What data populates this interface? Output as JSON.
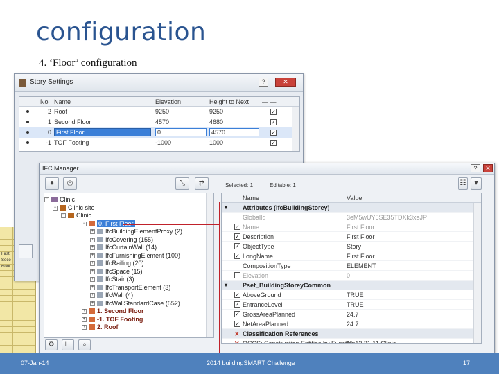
{
  "slide": {
    "title": "configuration",
    "subtitle": "4. ‘Floor’ configuration",
    "footer_date": "07-Jan-14",
    "footer_center": "2014 buildingSMART Challenge",
    "page_number": "17"
  },
  "story_settings": {
    "title": "Story Settings",
    "columns": {
      "no": "No",
      "name": "Name",
      "elevation": "Elevation",
      "height": "Height to Next",
      "show": "— —"
    },
    "rows": [
      {
        "no": "2",
        "name": "Roof",
        "elevation": "9250",
        "height": "9250",
        "checked": true,
        "selected": false
      },
      {
        "no": "1",
        "name": "Second Floor",
        "elevation": "4570",
        "height": "4680",
        "checked": true,
        "selected": false
      },
      {
        "no": "0",
        "name": "First Floor",
        "elevation": "0",
        "height": "4570",
        "checked": true,
        "selected": true
      },
      {
        "no": "-1",
        "name": "TOF Footing",
        "elevation": "-1000",
        "height": "1000",
        "checked": true,
        "selected": false
      }
    ]
  },
  "sheet_fragment": [
    "First",
    "Seco",
    "Roof"
  ],
  "ifc_manager": {
    "title": "IFC Manager",
    "selected_label": "Selected:",
    "selected_value": "1",
    "editable_label": "Editable:",
    "editable_value": "1",
    "tree": [
      {
        "label": "Clinic",
        "level": 0
      },
      {
        "label": "Clinic site",
        "level": 1
      },
      {
        "label": "Clinic",
        "level": 2
      },
      {
        "label": "0. First Floor",
        "level": 3,
        "highlight": true
      },
      {
        "label": "IfcBuildingElementProxy (2)",
        "level": 4
      },
      {
        "label": "IfcCovering (155)",
        "level": 4
      },
      {
        "label": "IfcCurtainWall (14)",
        "level": 4
      },
      {
        "label": "IfcFurnishingElement (100)",
        "level": 4
      },
      {
        "label": "IfcRailing (20)",
        "level": 4
      },
      {
        "label": "IfcSpace (15)",
        "level": 4
      },
      {
        "label": "IfcStair (3)",
        "level": 4
      },
      {
        "label": "IfcTransportElement (3)",
        "level": 4
      },
      {
        "label": "IfcWall (4)",
        "level": 4
      },
      {
        "label": "IfcWallStandardCase (652)",
        "level": 4
      },
      {
        "label": "1. Second Floor",
        "level": 3,
        "bold": true
      },
      {
        "label": "-1. TOF Footing",
        "level": 3,
        "bold": true
      },
      {
        "label": "2. Roof",
        "level": 3,
        "bold": true
      }
    ],
    "props_header": {
      "name": "Name",
      "value": "Value"
    },
    "props": [
      {
        "type": "group",
        "name": "Attributes (IfcBuildingStorey)",
        "value": ""
      },
      {
        "type": "row",
        "name": "GlobalId",
        "value": "3eM5wUY5SE35TDXk3xeJP",
        "check": "none",
        "dim": true
      },
      {
        "type": "row",
        "name": "Name",
        "value": "First Floor",
        "check": "on",
        "dim": true
      },
      {
        "type": "row",
        "name": "Description",
        "value": "First Floor",
        "check": "on"
      },
      {
        "type": "row",
        "name": "ObjectType",
        "value": "Story",
        "check": "on"
      },
      {
        "type": "row",
        "name": "LongName",
        "value": "First Floor",
        "check": "on"
      },
      {
        "type": "row",
        "name": "CompositionType",
        "value": "ELEMENT",
        "check": "none"
      },
      {
        "type": "row",
        "name": "Elevation",
        "value": "0",
        "check": "off",
        "dim": true
      },
      {
        "type": "group",
        "name": "Pset_BuildingStoreyCommon",
        "value": ""
      },
      {
        "type": "row",
        "name": "AboveGround",
        "value": "TRUE",
        "check": "on"
      },
      {
        "type": "row",
        "name": "EntranceLevel",
        "value": "TRUE",
        "check": "on"
      },
      {
        "type": "row",
        "name": "GrossAreaPlanned",
        "value": "24.7",
        "check": "on"
      },
      {
        "type": "row",
        "name": "NetAreaPlanned",
        "value": "24.7",
        "check": "on"
      },
      {
        "type": "group",
        "name": "Classification References",
        "value": "",
        "x": true
      },
      {
        "type": "row",
        "name": "OCCS: Construction Entities by Function",
        "value": "11-13 21 11 Clinic",
        "check": "x"
      }
    ]
  },
  "colors": {
    "accent": "#4f81bd",
    "title": "#2a5490",
    "highlight_line": "#c0212a",
    "selection": "#3b7fd8"
  }
}
